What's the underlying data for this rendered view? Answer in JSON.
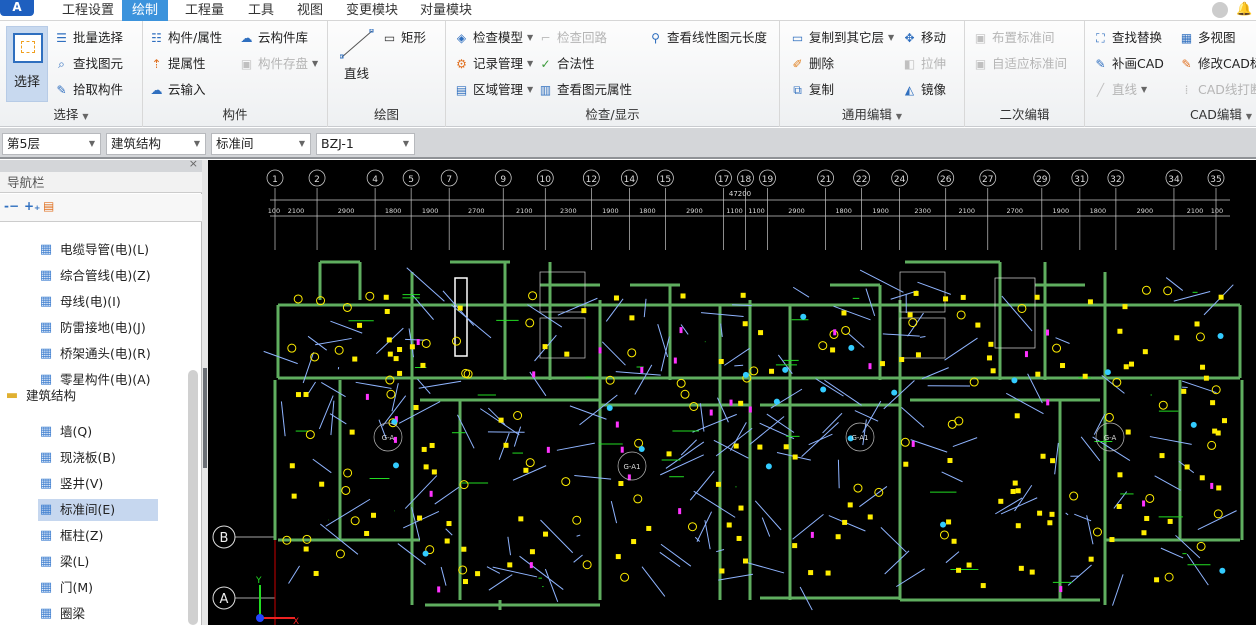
{
  "app": {
    "logo": "A",
    "tabs": [
      {
        "label": "工程设置"
      },
      {
        "label": "绘制",
        "active": true
      },
      {
        "label": "工程量"
      },
      {
        "label": "工具"
      },
      {
        "label": "视图"
      },
      {
        "label": "变更模块"
      },
      {
        "label": "对量模块"
      }
    ],
    "icons": [
      "user-avatar-icon",
      "bell-icon"
    ]
  },
  "ribbon": {
    "select": {
      "label": "选择",
      "big": "选择",
      "items": [
        "批量选择",
        "查找图元",
        "拾取构件"
      ]
    },
    "component": {
      "label": "构件",
      "items": [
        "构件/属性",
        "提属性",
        "云输入",
        "云构件库",
        "构件存盘"
      ]
    },
    "draw": {
      "label": "绘图",
      "items": [
        "直线",
        "矩形"
      ]
    },
    "check": {
      "label": "检查/显示",
      "items": [
        "检查模型",
        "记录管理",
        "区域管理",
        "检查回路",
        "合法性",
        "查看图元属性",
        "查看线性图元长度"
      ]
    },
    "edit": {
      "label": "通用编辑",
      "items": [
        "复制到其它层",
        "删除",
        "复制",
        "移动",
        "拉伸",
        "镜像"
      ]
    },
    "secondary": {
      "label": "二次编辑",
      "items": [
        "布置标准间",
        "自适应标准间"
      ]
    },
    "cad": {
      "label": "CAD编辑",
      "items": [
        "查找替换",
        "补画CAD",
        "直线",
        "多视图",
        "修改CAD标",
        "CAD线打断"
      ]
    }
  },
  "toolbar": {
    "floor": "第5层",
    "category": "建筑结构",
    "type": "标准间",
    "component": "BZJ-1"
  },
  "nav": {
    "title": "导航栏",
    "items": [
      {
        "label": "电缆导管(电)(L)",
        "icon": "conduit-icon"
      },
      {
        "label": "综合管线(电)(Z)",
        "icon": "pipeline-icon"
      },
      {
        "label": "母线(电)(I)",
        "icon": "busbar-icon"
      },
      {
        "label": "防雷接地(电)(J)",
        "icon": "lightning-icon"
      },
      {
        "label": "桥架通头(电)(R)",
        "icon": "tray-fitting-icon"
      },
      {
        "label": "零星构件(电)(A)",
        "icon": "grid-icon"
      }
    ],
    "folder": "建筑结构",
    "struct_items": [
      {
        "label": "墙(Q)",
        "icon": "wall-icon"
      },
      {
        "label": "现浇板(B)",
        "icon": "slab-icon"
      },
      {
        "label": "竖井(V)",
        "icon": "shaft-icon"
      },
      {
        "label": "标准间(E)",
        "icon": "standard-room-icon",
        "selected": true
      },
      {
        "label": "框柱(Z)",
        "icon": "column-icon"
      },
      {
        "label": "梁(L)",
        "icon": "beam-icon"
      },
      {
        "label": "门(M)",
        "icon": "door-icon"
      },
      {
        "label": "圈梁",
        "icon": "ring-beam-icon"
      }
    ]
  },
  "cad": {
    "axes": [
      "1",
      "2",
      "4",
      "5",
      "7",
      "9",
      "10",
      "12",
      "14",
      "15",
      "17",
      "18",
      "19",
      "21",
      "22",
      "24",
      "26",
      "27",
      "29",
      "31",
      "32",
      "34",
      "35"
    ],
    "dims": [
      "100",
      "2100",
      "2900",
      "1800",
      "1900",
      "2700",
      "2100",
      "2300",
      "1900",
      "1800",
      "2900",
      "1100",
      "1100",
      "2900",
      "1800",
      "1900",
      "2300",
      "2100",
      "2700",
      "1900",
      "1800",
      "2900",
      "2100",
      "100"
    ],
    "total": "47200",
    "row_axes": [
      "B",
      "A"
    ],
    "room_labels": [
      "G-A",
      "G-A1",
      "G-A1",
      "G-A"
    ],
    "ucs": {
      "x": "X",
      "y": "Y"
    },
    "colors": {
      "wall": "#5fae5f",
      "wire": "#8fb4ff",
      "device": "#ffee00",
      "grid": "#c8c8c8"
    }
  }
}
